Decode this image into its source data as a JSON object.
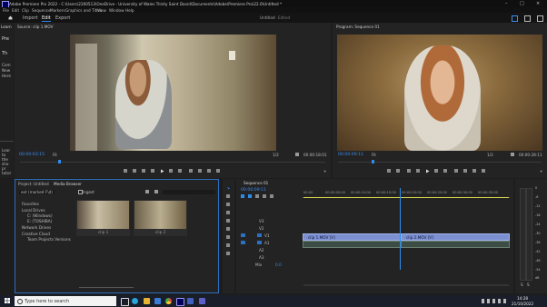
{
  "window": {
    "title": "Adobe Premiere Pro 2022 - C:\\Users\\2200513\\OneDrive - University of Wales Trinity Saint David\\Documents\\Adobe\\Premiere Pro\\22.0\\Untitled *",
    "controls": [
      "–",
      "□",
      "×"
    ]
  },
  "menu": [
    "File",
    "Edit",
    "Clip",
    "Sequence",
    "Markers",
    "Graphics and Titles",
    "View",
    "Window",
    "Help"
  ],
  "workspace": {
    "tabs": [
      "Import",
      "Edit",
      "Export"
    ],
    "active_tab": "Edit",
    "project_name": "Untitled",
    "project_status": "- Edited"
  },
  "left_strip_text": [
    "Learn",
    "Pre",
    "Th",
    "Com",
    "New",
    "Here"
  ],
  "left_strip_text2": [
    "Lear",
    "to",
    "the",
    "sho",
    "pr",
    "tutor"
  ],
  "source": {
    "tab": "Source: clip 1.MOV",
    "timecode": "00:00:03:15",
    "fit": "Fit",
    "ratio": "1/2",
    "duration": "00:00:18:01"
  },
  "program": {
    "tab": "Program: Sequence 01",
    "timecode": "00:00:09:11",
    "fit": "Fit",
    "ratio": "1/2",
    "duration": "00:00:28:11"
  },
  "project": {
    "tabs": [
      "Project: Untitled",
      "Media Browser"
    ],
    "path": "ext (marked F\\d)",
    "ingest_label": "Ingest",
    "tree": [
      "Favorites",
      "Local Drives",
      "C: (Windows)",
      "E: (TOSHIBA)",
      "Network Drives",
      "Creative Cloud",
      "Team Projects Versions"
    ],
    "thumbs": [
      {
        "name": "clip 1",
        "len": ""
      },
      {
        "name": "clip 2",
        "len": ""
      }
    ]
  },
  "sequence": {
    "tab": "Sequence 01",
    "timecode": "00:00:09:11",
    "ruler": [
      "00:00",
      "00:00:05:00",
      "00:00:10:00",
      "00:00:15:00",
      "00:00:20:00",
      "00:00:25:00",
      "00:00:30:00",
      "00:00:35:00"
    ],
    "tracks": [
      "V3",
      "V2",
      "V1",
      "A1",
      "A2",
      "A3",
      "Mix"
    ],
    "clips": [
      "clip 1.MOV [V]",
      "clip 2.MOV [V]"
    ],
    "mix_value": "0.0"
  },
  "meter": {
    "labels": [
      "0",
      "-6",
      "-12",
      "-18",
      "-24",
      "-30",
      "-36",
      "-42",
      "-48",
      "-54",
      "dB"
    ],
    "footer": [
      "S",
      "S"
    ]
  },
  "taskbar": {
    "search_placeholder": "Type here to search",
    "time": "14:28",
    "date": "21/10/2022"
  },
  "colors": {
    "accent": "#2d8ceb",
    "clip": "#7b8fd1",
    "timecode": "#3d8df0"
  }
}
